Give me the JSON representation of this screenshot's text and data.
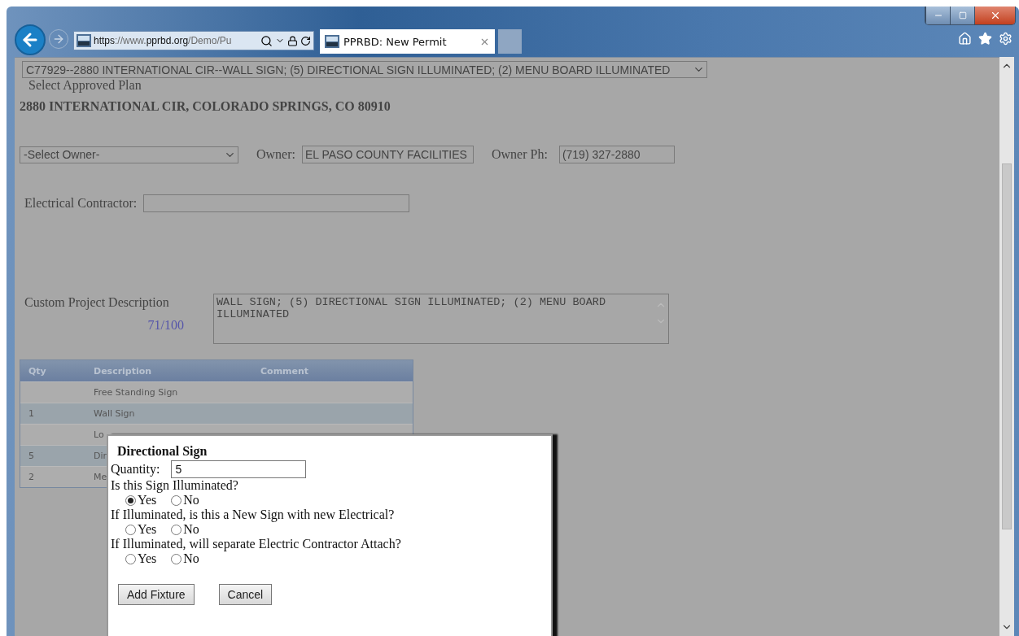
{
  "browser": {
    "address_parts": [
      {
        "text": "https",
        "strong": true
      },
      {
        "text": "://www.",
        "strong": false
      },
      {
        "text": "pprbd.org",
        "strong": true
      },
      {
        "text": "/Demo/Pu",
        "strong": false
      }
    ],
    "tab": {
      "title": "PPRBD: New Permit"
    }
  },
  "page": {
    "plan_select": {
      "value": "C77929--2880 INTERNATIONAL CIR--WALL SIGN; (5) DIRECTIONAL SIGN ILLUMINATED; (2) MENU BOARD ILLUMINATED"
    },
    "plan_label": "Select Approved Plan",
    "address": "2880 INTERNATIONAL CIR, COLORADO SPRINGS, CO 80910",
    "owner_select": {
      "value": "-Select Owner-"
    },
    "owner": {
      "label": "Owner:",
      "value": "EL PASO COUNTY FACILITIES"
    },
    "owner_phone": {
      "label": "Owner Ph:",
      "value": "(719) 327-2880"
    },
    "electrical_contractor": {
      "label": "Electrical Contractor:"
    },
    "description": {
      "label": "Custom Project Description",
      "counter": "71/100",
      "value": "WALL SIGN; (5) DIRECTIONAL SIGN ILLUMINATED; (2) MENU BOARD ILLUMINATED"
    },
    "table": {
      "columns": [
        "Qty",
        "Description",
        "Comment"
      ],
      "rows": [
        {
          "qty": "",
          "description": "Free Standing Sign"
        },
        {
          "qty": "1",
          "description": "Wall Sign"
        },
        {
          "qty": "",
          "description": "Lo"
        },
        {
          "qty": "5",
          "description": "Dir"
        },
        {
          "qty": "2",
          "description": "Me"
        }
      ]
    }
  },
  "dialog": {
    "title": "Directional Sign",
    "quantity": {
      "label": "Quantity:",
      "value": "5"
    },
    "questions": [
      {
        "text": "Is this Sign Illuminated?",
        "options": [
          {
            "label": "Yes",
            "selected": true
          },
          {
            "label": "No",
            "selected": false
          }
        ]
      },
      {
        "text": "If Illuminated, is this a New Sign with new Electrical?",
        "options": [
          {
            "label": "Yes",
            "selected": false
          },
          {
            "label": "No",
            "selected": false
          }
        ]
      },
      {
        "text": "If Illuminated, will separate Electric Contractor Attach?",
        "options": [
          {
            "label": "Yes",
            "selected": false
          },
          {
            "label": "No",
            "selected": false
          }
        ]
      }
    ],
    "buttons": [
      "Add Fixture",
      "Cancel"
    ]
  }
}
